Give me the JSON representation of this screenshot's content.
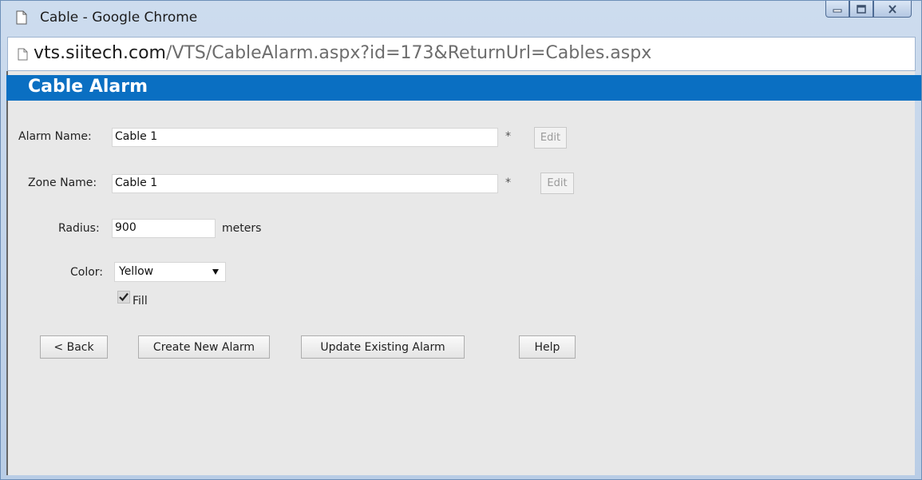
{
  "window": {
    "title": "Cable - Google Chrome",
    "url_host": "vts.siitech.com",
    "url_path": "/VTS/CableAlarm.aspx?id=173&ReturnUrl=Cables.aspx"
  },
  "header": {
    "title": "Cable Alarm"
  },
  "form": {
    "alarm_name": {
      "label": "Alarm Name:",
      "value": "Cable 1",
      "required_marker": "*",
      "edit_label": "Edit"
    },
    "zone_name": {
      "label": "Zone Name:",
      "value": "Cable 1",
      "required_marker": "*",
      "edit_label": "Edit"
    },
    "radius": {
      "label": "Radius:",
      "value": "900",
      "unit": "meters"
    },
    "color": {
      "label": "Color:",
      "selected": "Yellow"
    },
    "fill": {
      "label": "Fill",
      "checked": true
    }
  },
  "buttons": {
    "back": "< Back",
    "create": "Create New Alarm",
    "update": "Update Existing Alarm",
    "help": "Help"
  },
  "colors": {
    "header_bg": "#0a6fc2",
    "content_bg": "#e8e8e8"
  }
}
